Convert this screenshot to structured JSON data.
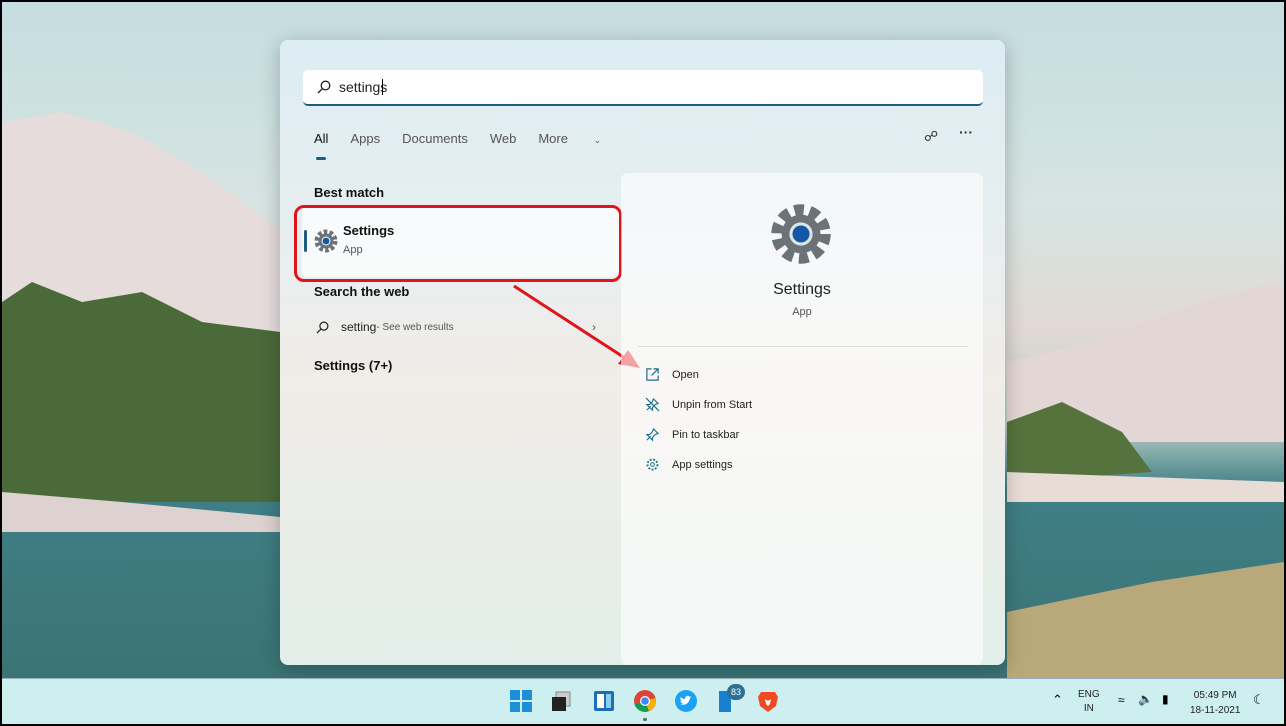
{
  "search": {
    "value": "settings"
  },
  "tabs": [
    "All",
    "Apps",
    "Documents",
    "Web",
    "More"
  ],
  "best_match": {
    "header": "Best match",
    "title": "Settings",
    "subtitle": "App"
  },
  "web": {
    "header": "Search the web",
    "query": "setting",
    "suffix": " - See web results"
  },
  "more_results": "Settings (7+)",
  "detail": {
    "title": "Settings",
    "subtitle": "App",
    "actions": [
      "Open",
      "Unpin from Start",
      "Pin to taskbar",
      "App settings"
    ]
  },
  "taskbar": {
    "badge": "83",
    "lang1": "ENG",
    "lang2": "IN",
    "time": "05:49 PM",
    "date": "18-11-2021"
  },
  "colors": {
    "accent": "#1d5e7a",
    "annotation": "#e0141b"
  }
}
